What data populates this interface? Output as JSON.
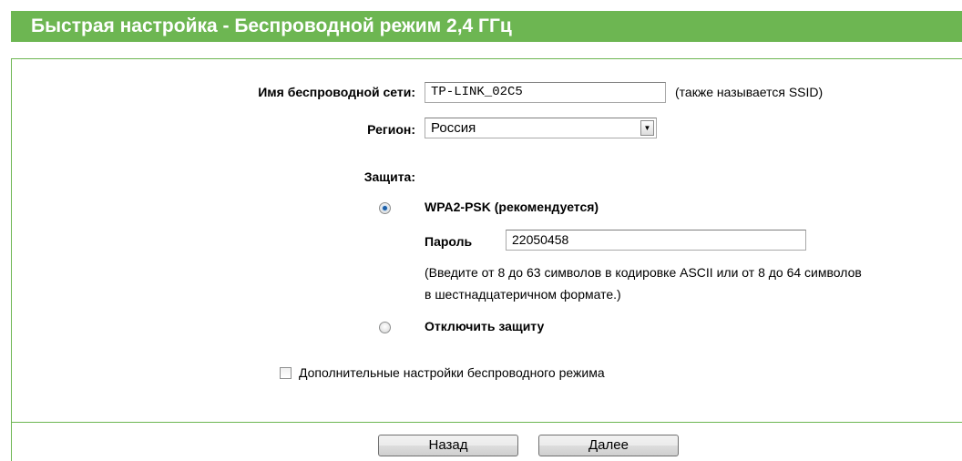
{
  "header": {
    "title": "Быстрая настройка - Беспроводной режим 2,4 ГГц"
  },
  "form": {
    "ssid": {
      "label": "Имя беспроводной сети:",
      "value": "TP-LINK_02C5",
      "hint": "(также называется SSID)"
    },
    "region": {
      "label": "Регион:",
      "selected": "Россия"
    },
    "security": {
      "label": "Защита:",
      "wpa2": {
        "label": "WPA2-PSK (рекомендуется)",
        "checked": true
      },
      "password": {
        "label": "Пароль",
        "value": "22050458",
        "hint_line1": "(Введите от 8 до 63 символов в кодировке ASCII или от 8 до 64 символов",
        "hint_line2": "в шестнадцатеричном формате.)"
      },
      "disable": {
        "label": "Отключить защиту",
        "checked": false
      }
    },
    "advanced": {
      "label": "Дополнительные настройки беспроводного режима",
      "checked": false
    }
  },
  "buttons": {
    "back": "Назад",
    "next": "Далее"
  },
  "colors": {
    "accent": "#6db652",
    "radio_dot": "#1b5fa8"
  }
}
